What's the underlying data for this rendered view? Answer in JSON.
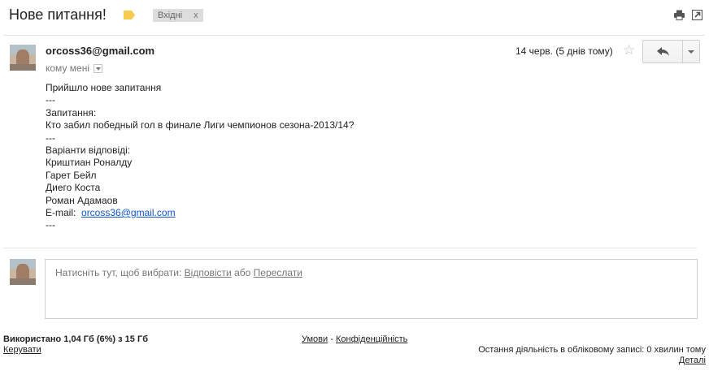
{
  "subject": "Нове питання!",
  "label_color": "#f7cb4d",
  "inbox_chip": {
    "label": "Вхідні",
    "close": "x"
  },
  "message": {
    "sender": "orcoss36@gmail.com",
    "to": "кому мені",
    "date": "14 черв. (5 днів тому)",
    "body": [
      "Прийшло нове запитання",
      "---",
      "Запитання:",
      "Кто забил победный гол в финале Лиги чемпионов сезона-2013/14?",
      "---",
      "Варіанти відповіді:",
      "Криштиан Роналду",
      "Гарет Бейл",
      "Диего Коста",
      "Роман Адамаов"
    ],
    "email_label": "E-mail:",
    "email_link": "orcoss36@gmail.com",
    "body_end": "---"
  },
  "reply_box": {
    "prefix": "Натисніть тут, щоб вибрати:",
    "reply_link": "Відповісти",
    "or": "або",
    "forward_link": "Переслати"
  },
  "footer": {
    "storage": "Використано 1,04 Гб (6%) з 15 Гб",
    "manage": "Керувати",
    "terms": "Умови",
    "sep": "-",
    "privacy": "Конфіденційність",
    "last_activity": "Остання діяльність в обліковому записі: 0 хвилин тому",
    "details": "Деталі"
  },
  "icons": [
    "label-tag-icon",
    "print-icon",
    "new-window-icon",
    "star-icon",
    "reply-icon",
    "more-dropdown-icon",
    "dropdown-arrow-icon"
  ]
}
